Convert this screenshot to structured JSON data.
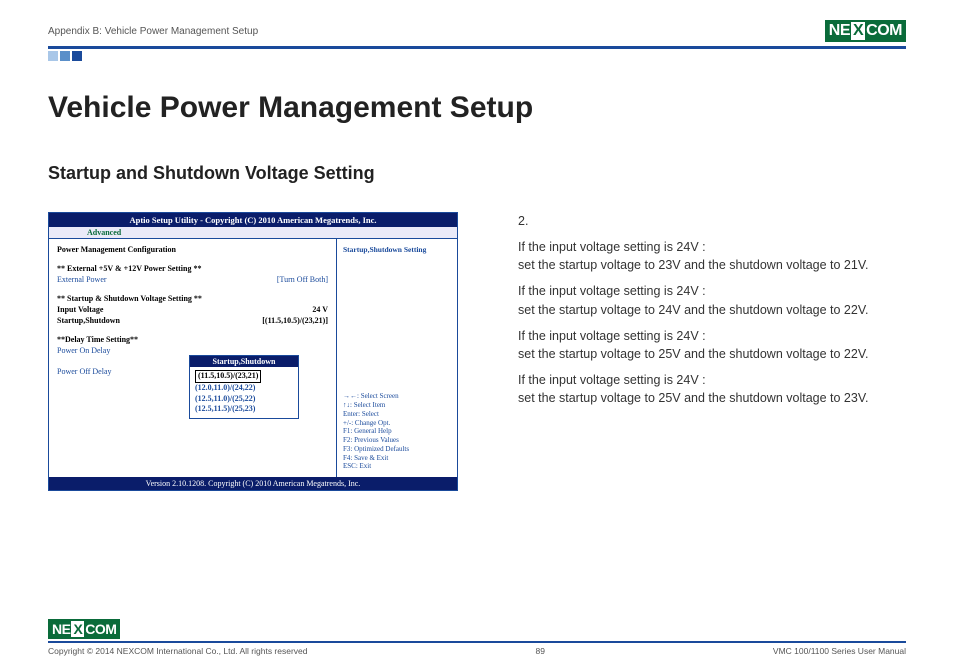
{
  "header": {
    "breadcrumb": "Appendix B: Vehicle Power Management Setup",
    "logo_text_left": "NE",
    "logo_text_x": "X",
    "logo_text_right": "COM"
  },
  "titles": {
    "main": "Vehicle Power Management Setup",
    "sub": "Startup and Shutdown Voltage Setting"
  },
  "bios": {
    "title": "Aptio Setup Utility - Copyright (C) 2010 American Megatrends, Inc.",
    "tab": "Advanced",
    "section_heading": "Power Management Configuration",
    "ext_power_heading": "** External +5V & +12V Power Setting **",
    "ext_power_label": "External Power",
    "ext_power_value": "[Turn Off Both]",
    "ss_heading": "** Startup & Shutdown Voltage Setting **",
    "input_voltage_label": "Input Voltage",
    "input_voltage_value": "24 V",
    "startup_shutdown_label": "Startup,Shutdown",
    "startup_shutdown_value": "[(11.5,10.5)/(23,21)]",
    "delay_heading": "**Delay Time Setting**",
    "power_on_delay": "Power On Delay",
    "power_off_delay": "Power Off Delay",
    "popup_title": "Startup,Shutdown",
    "popup_items": [
      "(11.5,10.5)/(23,21)",
      "(12.0,11.0)/(24,22)",
      "(12.5,11.0)/(25,22)",
      "(12.5,11.5)/(25,23)"
    ],
    "help_title": "Startup,Shutdown Setting",
    "keys": [
      "→←: Select Screen",
      "↑↓: Select Item",
      "Enter: Select",
      "+/-: Change Opt.",
      "F1: General Help",
      "F2: Previous Values",
      "F3: Optimized Defaults",
      "F4: Save & Exit",
      "ESC: Exit"
    ],
    "footer": "Version 2.10.1208. Copyright (C) 2010 American Megatrends, Inc."
  },
  "right": {
    "num": "2.",
    "p1a": "If the input voltage setting is 24V :",
    "p1b": "set the startup voltage to 23V and the shutdown voltage to 21V.",
    "p2a": "If the input voltage setting is 24V :",
    "p2b": "set the startup voltage to 24V and the shutdown voltage to 22V.",
    "p3a": "If the input voltage setting is 24V :",
    "p3b": "set the startup voltage to 25V and the shutdown voltage to 22V.",
    "p4a": "If the input voltage setting is 24V :",
    "p4b": "set the startup voltage to 25V and the shutdown voltage to 23V."
  },
  "footer": {
    "copyright": "Copyright © 2014 NEXCOM International Co., Ltd. All rights reserved",
    "page": "89",
    "manual": "VMC 100/1100 Series User Manual"
  }
}
